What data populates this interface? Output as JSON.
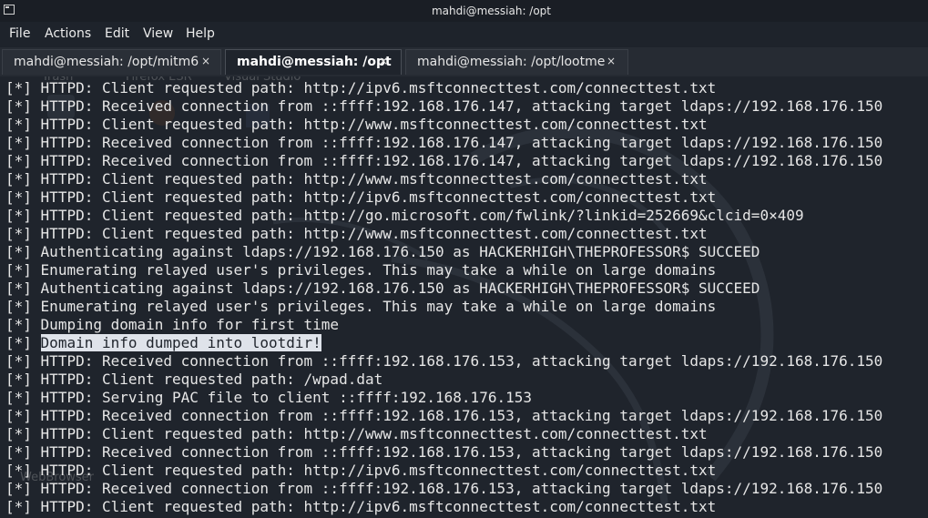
{
  "window": {
    "title": "mahdi@messiah: /opt"
  },
  "menu": [
    "File",
    "Actions",
    "Edit",
    "View",
    "Help"
  ],
  "tabs": [
    {
      "label": "mahdi@messiah: /opt/mitm6",
      "active": false
    },
    {
      "label": "mahdi@messiah: /opt",
      "active": true
    },
    {
      "label": "mahdi@messiah: /opt/lootme",
      "active": false
    }
  ],
  "tab_close_glyph": "×",
  "desktop_ghost_labels": [
    "Trash",
    "Firefox ESR",
    "Visual Studio",
    "WebBrowser"
  ],
  "terminal": {
    "prefix": "[*]",
    "lines": [
      "HTTPD: Client requested path: http://ipv6.msftconnecttest.com/connecttest.txt",
      "HTTPD: Received connection from ::ffff:192.168.176.147, attacking target ldaps://192.168.176.150",
      "HTTPD: Client requested path: http://www.msftconnecttest.com/connecttest.txt",
      "HTTPD: Received connection from ::ffff:192.168.176.147, attacking target ldaps://192.168.176.150",
      "HTTPD: Received connection from ::ffff:192.168.176.147, attacking target ldaps://192.168.176.150",
      "HTTPD: Client requested path: http://www.msftconnecttest.com/connecttest.txt",
      "HTTPD: Client requested path: http://ipv6.msftconnecttest.com/connecttest.txt",
      "HTTPD: Client requested path: http://go.microsoft.com/fwlink/?linkid=252669&clcid=0×409",
      "HTTPD: Client requested path: http://www.msftconnecttest.com/connecttest.txt",
      "Authenticating against ldaps://192.168.176.150 as HACKERHIGH\\THEPROFESSOR$ SUCCEED",
      "Enumerating relayed user's privileges. This may take a while on large domains",
      "Authenticating against ldaps://192.168.176.150 as HACKERHIGH\\THEPROFESSOR$ SUCCEED",
      "Enumerating relayed user's privileges. This may take a while on large domains",
      "Dumping domain info for first time",
      "Domain info dumped into lootdir!",
      "HTTPD: Received connection from ::ffff:192.168.176.153, attacking target ldaps://192.168.176.150",
      "HTTPD: Client requested path: /wpad.dat",
      "HTTPD: Serving PAC file to client ::ffff:192.168.176.153",
      "HTTPD: Received connection from ::ffff:192.168.176.153, attacking target ldaps://192.168.176.150",
      "HTTPD: Client requested path: http://www.msftconnecttest.com/connecttest.txt",
      "HTTPD: Received connection from ::ffff:192.168.176.153, attacking target ldaps://192.168.176.150",
      "HTTPD: Client requested path: http://ipv6.msftconnecttest.com/connecttest.txt",
      "HTTPD: Received connection from ::ffff:192.168.176.153, attacking target ldaps://192.168.176.150",
      "HTTPD: Client requested path: http://ipv6.msftconnecttest.com/connecttest.txt"
    ],
    "highlighted_line_index": 14
  },
  "colors": {
    "terminal_bg": "#1f242c",
    "terminal_fg": "#e6e6e6",
    "selection_bg": "#dfe3ea"
  }
}
